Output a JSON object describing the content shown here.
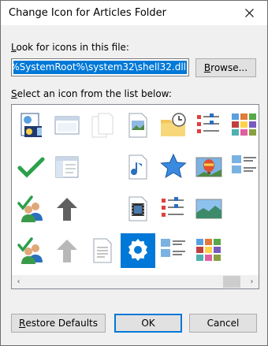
{
  "window": {
    "title": "Change Icon for Articles Folder"
  },
  "labels": {
    "look_prefix": "L",
    "look_rest": "ook for icons in this file:",
    "select_prefix": "S",
    "select_rest": "elect an icon from the list below:"
  },
  "path": {
    "value": "%SystemRoot%\\system32\\shell32.dll"
  },
  "buttons": {
    "browse_prefix": "B",
    "browse_rest": "rowse...",
    "restore_prefix": "R",
    "restore_rest": "estore Defaults",
    "ok": "OK",
    "cancel": "Cancel"
  },
  "icons": [
    {
      "name": "media-document-icon"
    },
    {
      "name": "window-icon"
    },
    {
      "name": "blank-pages-icon"
    },
    {
      "name": "picture-document-icon"
    },
    {
      "name": "folder-clock-icon"
    },
    {
      "name": "details-list-icon"
    },
    {
      "name": "color-tiles-icon"
    },
    {
      "name": "checkmark-icon"
    },
    {
      "name": "window-pane-icon"
    },
    {
      "name": "blank-icon"
    },
    {
      "name": "music-document-icon"
    },
    {
      "name": "star-icon"
    },
    {
      "name": "balloon-picture-icon"
    },
    {
      "name": "picture-list-icon"
    },
    {
      "name": "users-check-icon"
    },
    {
      "name": "up-arrow-icon"
    },
    {
      "name": "blank-icon"
    },
    {
      "name": "video-document-icon"
    },
    {
      "name": "details-list-icon"
    },
    {
      "name": "landscape-picture-icon"
    },
    {
      "name": "blank-icon"
    },
    {
      "name": "users-check-icon"
    },
    {
      "name": "up-arrow-light-icon"
    },
    {
      "name": "text-document-icon"
    },
    {
      "name": "gear-icon"
    },
    {
      "name": "picture-list-icon"
    },
    {
      "name": "color-tiles-icon"
    },
    {
      "name": "blank-icon"
    }
  ],
  "scrollbar": {
    "left_arrow": "‹",
    "right_arrow": "›"
  }
}
